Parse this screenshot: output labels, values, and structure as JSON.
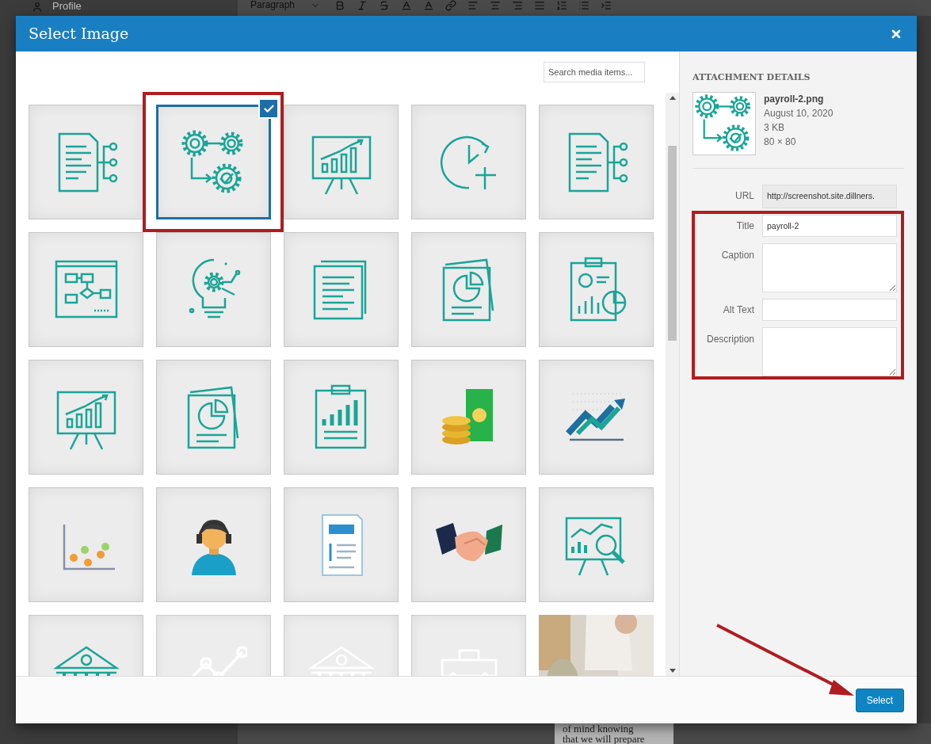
{
  "background": {
    "sidebar_item": "Profile",
    "block_format": "Paragraph",
    "body_lines": [
      "of mind knowing",
      "that we will prepare"
    ]
  },
  "window": {
    "title": "Select Image"
  },
  "search": {
    "placeholder": "Search media items..."
  },
  "tiles": [
    {
      "kind": "document-network",
      "selected": false,
      "faded": false
    },
    {
      "kind": "gears",
      "selected": true,
      "faded": false
    },
    {
      "kind": "chart-easel",
      "selected": false,
      "faded": false
    },
    {
      "kind": "clock",
      "selected": false,
      "faded": false
    },
    {
      "kind": "document-network",
      "selected": false,
      "faded": false
    },
    {
      "kind": "flowchart",
      "selected": false,
      "faded": false
    },
    {
      "kind": "bulb",
      "selected": false,
      "faded": false
    },
    {
      "kind": "papers",
      "selected": false,
      "faded": false
    },
    {
      "kind": "pie-papers",
      "selected": false,
      "faded": false
    },
    {
      "kind": "clipboard-report",
      "selected": false,
      "faded": false
    },
    {
      "kind": "chart-easel",
      "selected": false,
      "faded": false
    },
    {
      "kind": "pie-papers",
      "selected": false,
      "faded": false
    },
    {
      "kind": "clipboard-chart",
      "selected": false,
      "faded": false
    },
    {
      "kind": "coins",
      "selected": false,
      "faded": false
    },
    {
      "kind": "trend",
      "selected": false,
      "faded": false
    },
    {
      "kind": "scatter",
      "selected": false,
      "faded": false
    },
    {
      "kind": "person",
      "selected": false,
      "faded": false
    },
    {
      "kind": "invoice",
      "selected": false,
      "faded": false
    },
    {
      "kind": "handshake",
      "selected": false,
      "faded": false
    },
    {
      "kind": "magnifier-easel",
      "selected": false,
      "faded": false
    },
    {
      "kind": "bank",
      "selected": false,
      "faded": false
    },
    {
      "kind": "line-chart",
      "selected": false,
      "faded": true
    },
    {
      "kind": "bank",
      "selected": false,
      "faded": true
    },
    {
      "kind": "briefcase",
      "selected": false,
      "faded": true
    },
    {
      "kind": "picture",
      "selected": false,
      "faded": false
    }
  ],
  "details": {
    "heading": "ATTACHMENT DETAILS",
    "file_name": "payroll-2.png",
    "date": "August 10, 2020",
    "size": "3 KB",
    "dimensions": "80 × 80",
    "fields": [
      {
        "label": "URL",
        "kind": "text",
        "value": "http://screenshot.site.dillners.",
        "readonly": true
      },
      {
        "label": "Title",
        "kind": "text",
        "value": "payroll-2",
        "readonly": false
      },
      {
        "label": "Caption",
        "kind": "textarea",
        "readonly": false
      },
      {
        "label": "Alt Text",
        "kind": "text",
        "readonly": false
      },
      {
        "label": "Description",
        "kind": "textarea",
        "readonly": false
      }
    ]
  },
  "footer": {
    "button": "Select"
  }
}
